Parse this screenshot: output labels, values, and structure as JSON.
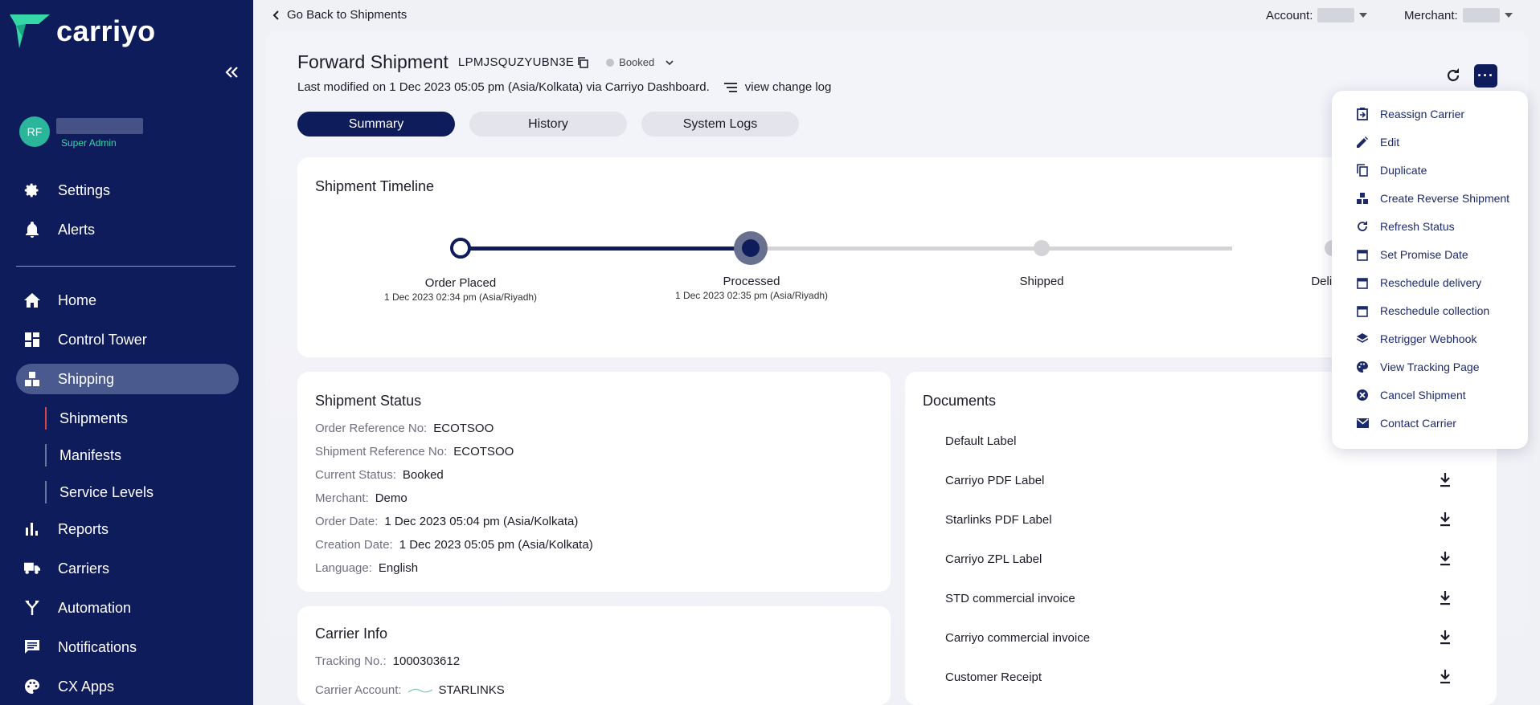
{
  "brand": {
    "name": "carriyo"
  },
  "user": {
    "initials": "RF",
    "role": "Super Admin"
  },
  "sidebar": {
    "items": [
      {
        "label": "Settings",
        "icon": "gear-icon"
      },
      {
        "label": "Alerts",
        "icon": "bell-icon"
      },
      {
        "label": "Home",
        "icon": "home-icon"
      },
      {
        "label": "Control Tower",
        "icon": "dashboard-icon"
      },
      {
        "label": "Shipping",
        "icon": "boxes-icon"
      },
      {
        "label": "Reports",
        "icon": "bar-chart-icon"
      },
      {
        "label": "Carriers",
        "icon": "truck-icon"
      },
      {
        "label": "Automation",
        "icon": "merge-icon"
      },
      {
        "label": "Notifications",
        "icon": "message-icon"
      },
      {
        "label": "CX Apps",
        "icon": "palette-icon"
      }
    ],
    "sub_items": [
      {
        "label": "Shipments"
      },
      {
        "label": "Manifests"
      },
      {
        "label": "Service Levels"
      }
    ]
  },
  "topbar": {
    "back_label": "Go Back to Shipments",
    "account_label": "Account:",
    "merchant_label": "Merchant:"
  },
  "header": {
    "title": "Forward Shipment",
    "shipment_id": "LPMJSQUZYUBN3E",
    "status": "Booked",
    "modified": "Last modified on 1 Dec 2023 05:05 pm (Asia/Kolkata) via Carriyo Dashboard.",
    "changelog": "view change log"
  },
  "tabs": [
    {
      "label": "Summary"
    },
    {
      "label": "History"
    },
    {
      "label": "System Logs"
    }
  ],
  "timeline": {
    "title": "Shipment Timeline",
    "steps": [
      {
        "name": "Order Placed",
        "date": "1 Dec 2023 02:34 pm (Asia/Riyadh)"
      },
      {
        "name": "Processed",
        "date": "1 Dec 2023 02:35 pm (Asia/Riyadh)"
      },
      {
        "name": "Shipped",
        "date": ""
      },
      {
        "name": "Deliv",
        "date": ""
      }
    ]
  },
  "status_card": {
    "title": "Shipment Status",
    "rows": [
      {
        "k": "Order Reference No:",
        "v": "ECOTSOO"
      },
      {
        "k": "Shipment Reference No:",
        "v": "ECOTSOO"
      },
      {
        "k": "Current Status:",
        "v": "Booked"
      },
      {
        "k": "Merchant:",
        "v": "Demo"
      },
      {
        "k": "Order Date:",
        "v": "1 Dec 2023 05:04 pm (Asia/Kolkata)"
      },
      {
        "k": "Creation Date:",
        "v": "1 Dec 2023 05:05 pm (Asia/Kolkata)"
      },
      {
        "k": "Language:",
        "v": "English"
      }
    ]
  },
  "carrier_card": {
    "title": "Carrier Info",
    "tracking_k": "Tracking No.:",
    "tracking_v": "1000303612",
    "account_k": "Carrier Account:",
    "account_v": "STARLINKS"
  },
  "documents": {
    "title": "Documents",
    "items": [
      {
        "label": "Default Label"
      },
      {
        "label": "Carriyo PDF Label"
      },
      {
        "label": "Starlinks PDF Label"
      },
      {
        "label": "Carriyo ZPL Label"
      },
      {
        "label": "STD commercial invoice"
      },
      {
        "label": "Carriyo commercial invoice"
      },
      {
        "label": "Customer Receipt"
      }
    ]
  },
  "menu": {
    "items": [
      {
        "label": "Reassign Carrier",
        "icon": "reassign-icon"
      },
      {
        "label": "Edit",
        "icon": "pencil-icon"
      },
      {
        "label": "Duplicate",
        "icon": "copy-icon"
      },
      {
        "label": "Create Reverse Shipment",
        "icon": "boxes-icon"
      },
      {
        "label": "Refresh Status",
        "icon": "refresh-icon"
      },
      {
        "label": "Set Promise Date",
        "icon": "calendar-icon"
      },
      {
        "label": "Reschedule delivery",
        "icon": "calendar-icon"
      },
      {
        "label": "Reschedule collection",
        "icon": "calendar-icon"
      },
      {
        "label": "Retrigger Webhook",
        "icon": "layers-icon"
      },
      {
        "label": "View Tracking Page",
        "icon": "palette-icon"
      },
      {
        "label": "Cancel Shipment",
        "icon": "cancel-icon"
      },
      {
        "label": "Contact Carrier",
        "icon": "mail-icon"
      }
    ]
  },
  "colors": {
    "sidebar_bg": "#0f1c5c",
    "accent_green": "#35d7a6",
    "active_nav": "#4a5a8e"
  }
}
